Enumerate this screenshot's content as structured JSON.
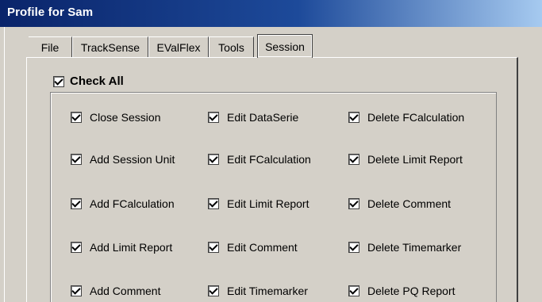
{
  "window": {
    "title": "Profile for Sam"
  },
  "tabs": [
    {
      "label": "File"
    },
    {
      "label": "TrackSense"
    },
    {
      "label": "EValFlex"
    },
    {
      "label": "Tools"
    },
    {
      "label": "Session",
      "active": true
    }
  ],
  "check_all": {
    "label": "Check All",
    "checked": true
  },
  "columns": [
    {
      "items": [
        {
          "label": "Close Session",
          "checked": true
        },
        {
          "label": "Add Session Unit",
          "checked": true
        },
        {
          "label": "Add FCalculation",
          "checked": true
        },
        {
          "label": "Add Limit Report",
          "checked": true
        },
        {
          "label": "Add Comment",
          "checked": true
        }
      ]
    },
    {
      "items": [
        {
          "label": "Edit DataSerie",
          "checked": true
        },
        {
          "label": "Edit FCalculation",
          "checked": true
        },
        {
          "label": "Edit Limit Report",
          "checked": true
        },
        {
          "label": "Edit Comment",
          "checked": true
        },
        {
          "label": "Edit Timemarker",
          "checked": true
        }
      ]
    },
    {
      "items": [
        {
          "label": "Delete FCalculation",
          "checked": true
        },
        {
          "label": "Delete Limit Report",
          "checked": true
        },
        {
          "label": "Delete Comment",
          "checked": true
        },
        {
          "label": "Delete Timemarker",
          "checked": true
        },
        {
          "label": "Delete PQ Report",
          "checked": true
        }
      ]
    }
  ]
}
